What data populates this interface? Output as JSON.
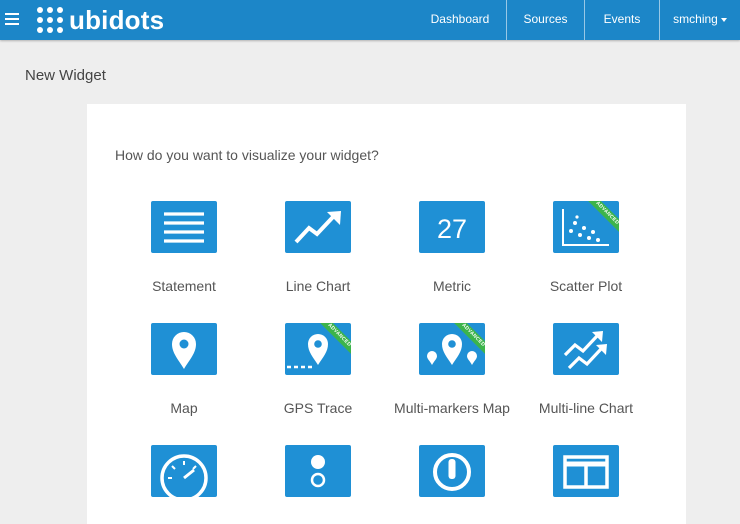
{
  "header": {
    "logo_text": "ubidots",
    "nav": {
      "dashboard": "Dashboard",
      "sources": "Sources",
      "events": "Events",
      "user": "smching"
    }
  },
  "page": {
    "title": "New Widget",
    "question": "How do you want to visualize your widget?"
  },
  "widgets": {
    "statement": {
      "label": "Statement"
    },
    "line_chart": {
      "label": "Line Chart"
    },
    "metric": {
      "label": "Metric",
      "icon_value": "27"
    },
    "scatter_plot": {
      "label": "Scatter Plot",
      "badge": "ADVANCED"
    },
    "map": {
      "label": "Map"
    },
    "gps_trace": {
      "label": "GPS Trace",
      "badge": "ADVANCED"
    },
    "multi_markers_map": {
      "label": "Multi-markers Map",
      "badge": "ADVANCED"
    },
    "multi_line_chart": {
      "label": "Multi-line Chart"
    },
    "row3": [
      {
        "icon": "gauge-icon"
      },
      {
        "icon": "indicator-icon"
      },
      {
        "icon": "switch-icon"
      },
      {
        "icon": "table-icon"
      }
    ]
  },
  "colors": {
    "topbar": "#1c86c8",
    "tile": "#1f90d5",
    "badge": "#3cb44b",
    "background": "#eeeeee"
  }
}
